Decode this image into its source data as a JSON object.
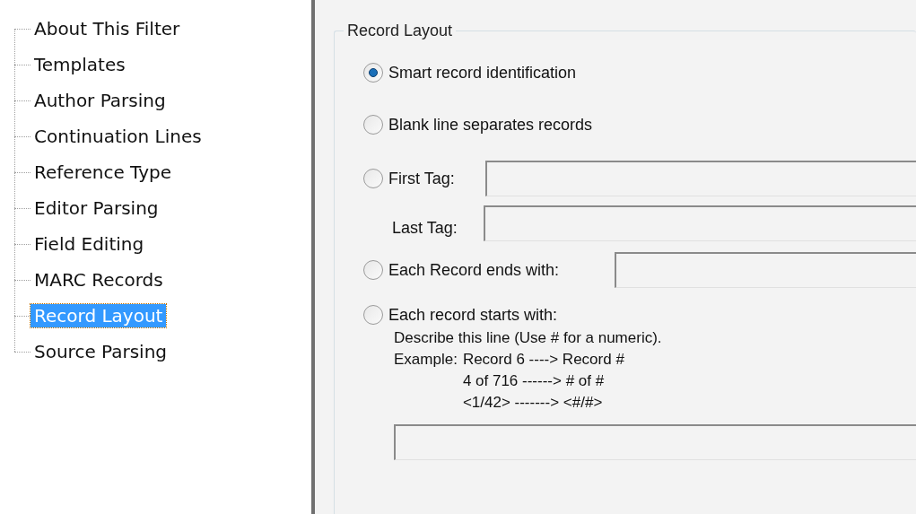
{
  "tree": {
    "items": [
      {
        "label": "About This Filter",
        "selected": false
      },
      {
        "label": "Templates",
        "selected": false
      },
      {
        "label": "Author Parsing",
        "selected": false
      },
      {
        "label": "Continuation Lines",
        "selected": false
      },
      {
        "label": "Reference Type",
        "selected": false
      },
      {
        "label": "Editor Parsing",
        "selected": false
      },
      {
        "label": "Field Editing",
        "selected": false
      },
      {
        "label": "MARC Records",
        "selected": false
      },
      {
        "label": "Record Layout",
        "selected": true
      },
      {
        "label": "Source Parsing",
        "selected": false
      }
    ]
  },
  "group": {
    "title": "Record Layout",
    "options": [
      {
        "kind": "plain",
        "label": "Smart record identification",
        "selected": true
      },
      {
        "kind": "plain",
        "label": "Blank line separates records",
        "selected": false
      },
      {
        "kind": "tags",
        "label": "First Tag:",
        "second_label": "Last Tag:",
        "selected": false
      },
      {
        "kind": "field",
        "label": "Each Record ends with:",
        "selected": false
      },
      {
        "kind": "pattern",
        "label": "Each record starts with:",
        "selected": false,
        "intro": "Describe this line (Use # for a numeric).",
        "example_label": "Example:",
        "examples": [
          "Record 6 ----> Record #",
          "4 of 716 ------> # of #",
          "<1/42> -------> <#/#>"
        ]
      }
    ]
  }
}
